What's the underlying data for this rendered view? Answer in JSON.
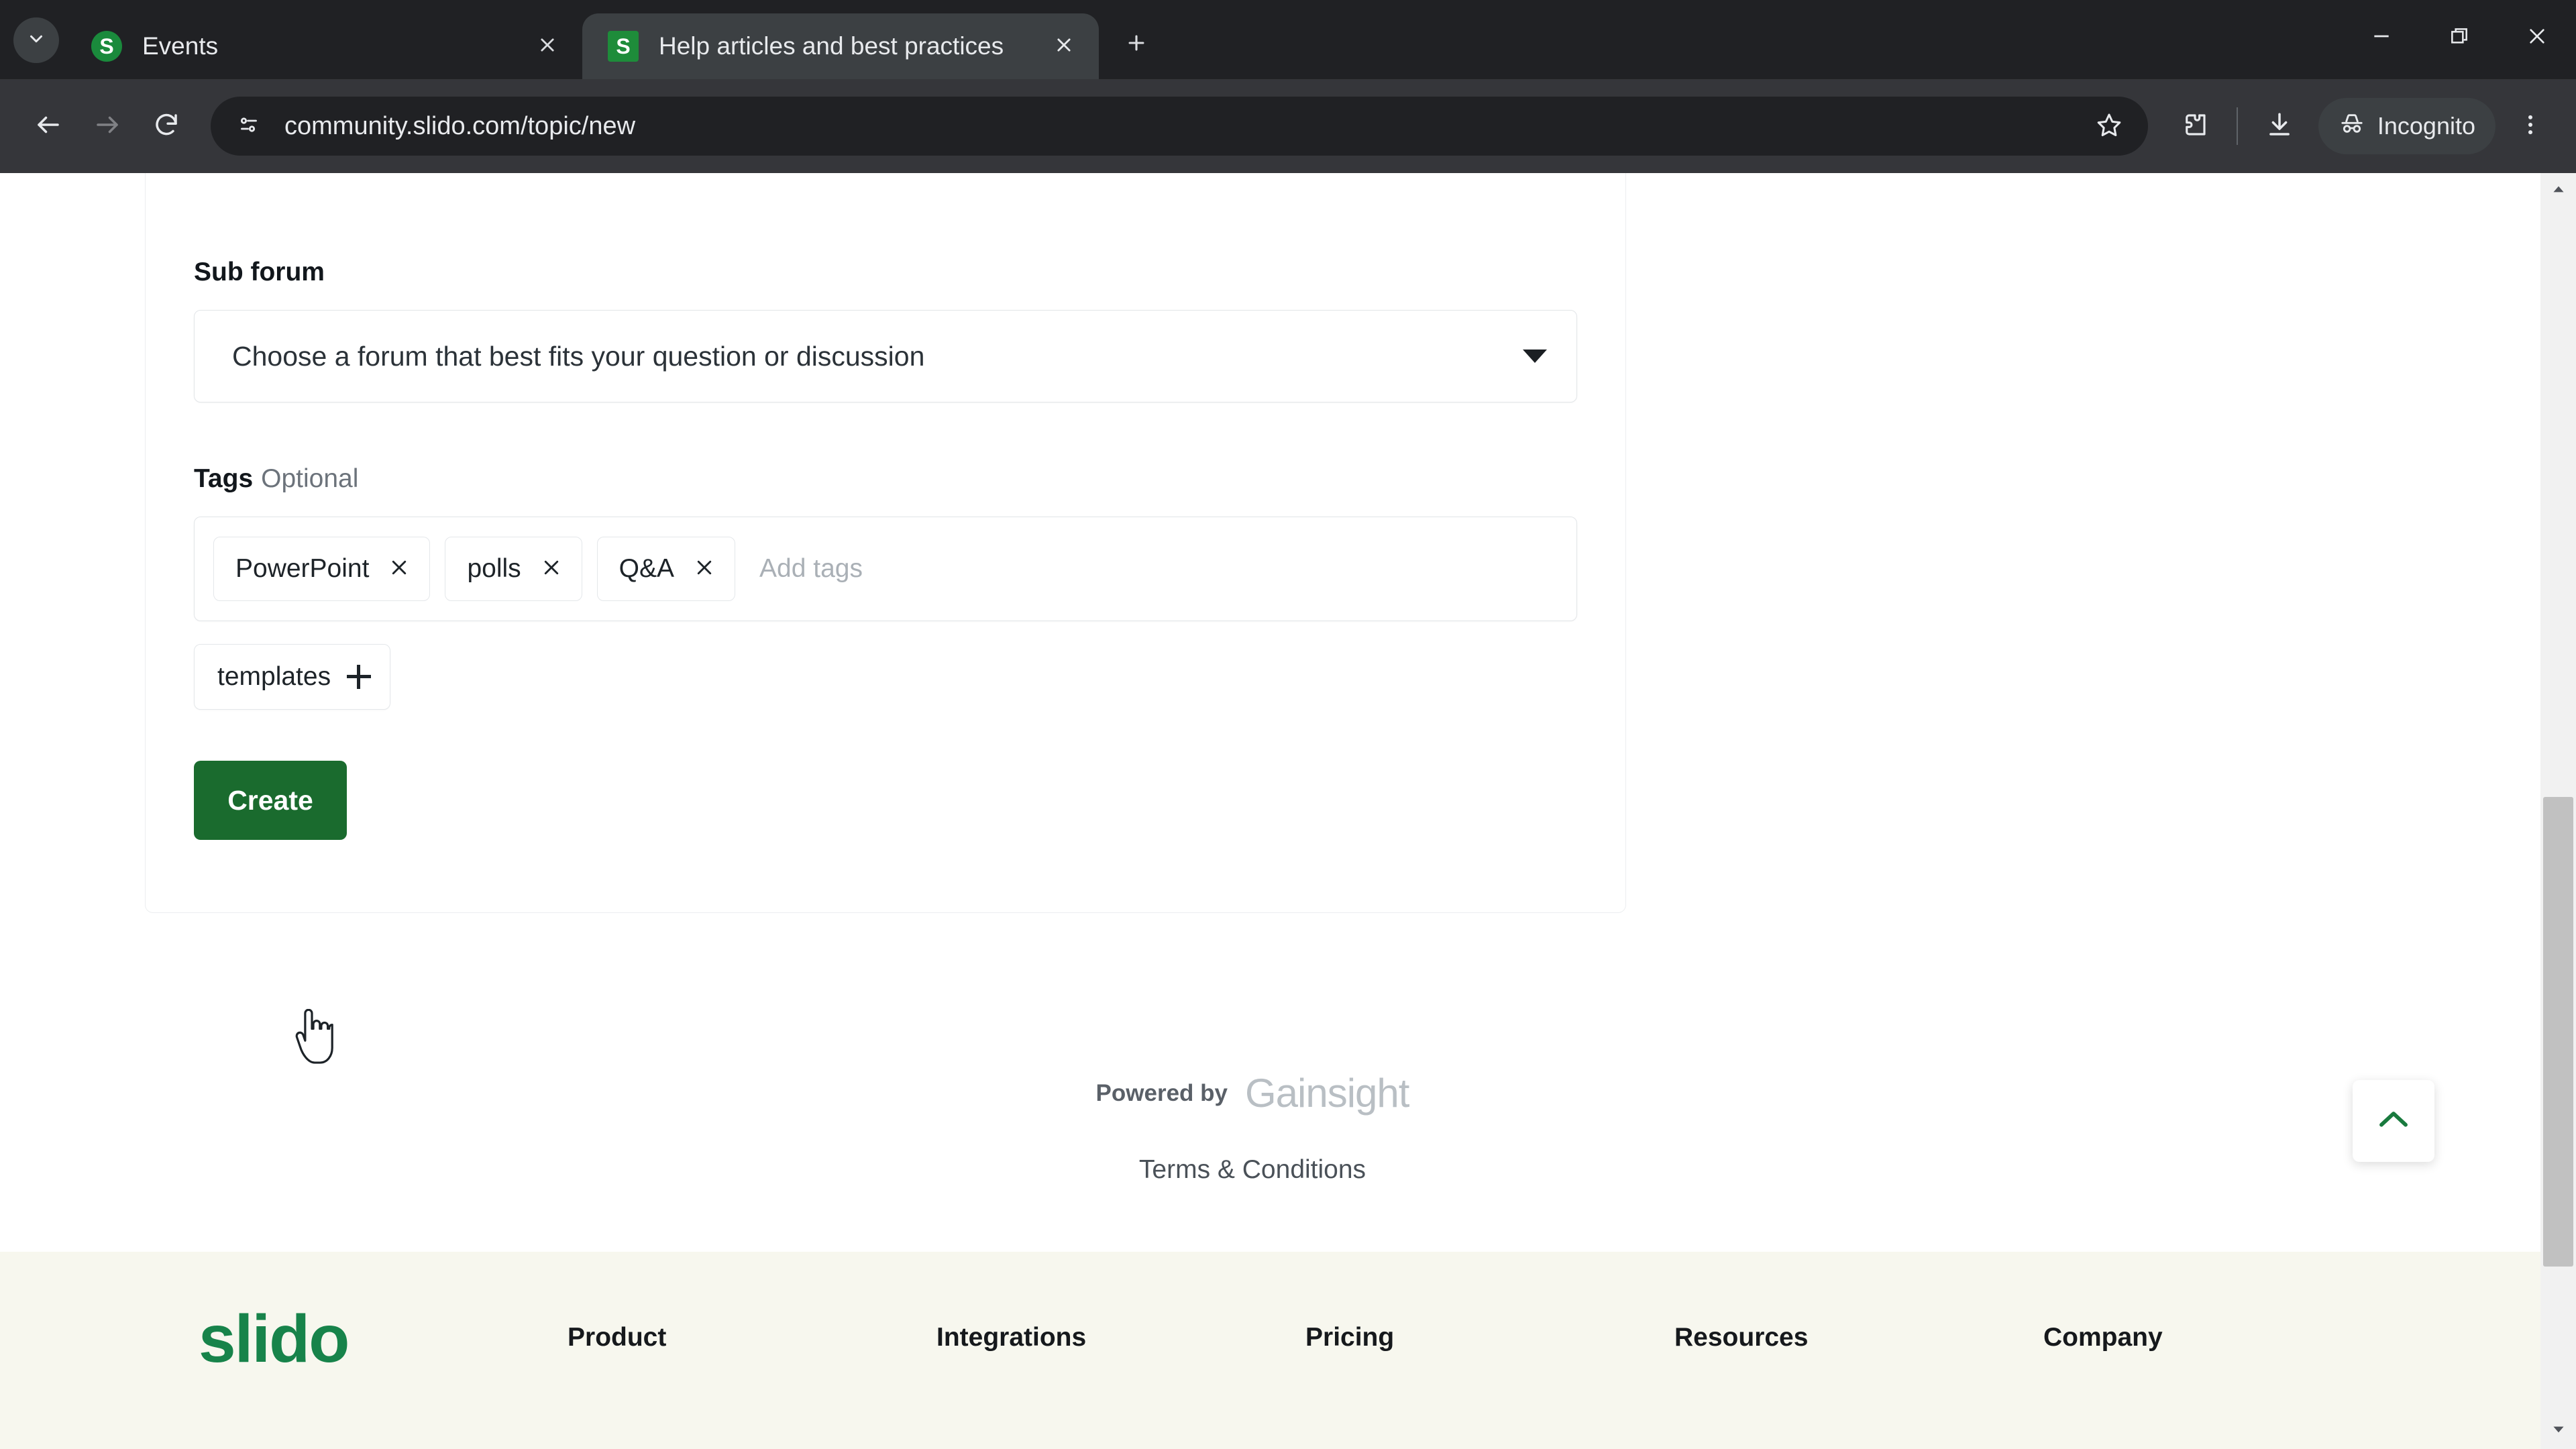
{
  "browser": {
    "tab_search_icon": "chevron-down-icon",
    "tabs": [
      {
        "title": "Events",
        "favicon_letter": "S",
        "favicon_shape": "round",
        "active": false
      },
      {
        "title": "Help articles and best practices",
        "favicon_letter": "S",
        "favicon_shape": "square",
        "active": true
      }
    ],
    "new_tab_icon": "plus-icon",
    "window_controls": [
      "minimize-icon",
      "restore-icon",
      "close-icon"
    ],
    "toolbar": {
      "back_icon": "arrow-left-icon",
      "forward_icon": "arrow-right-icon",
      "reload_icon": "reload-icon",
      "site_info_icon": "site-settings-icon",
      "url": "community.slido.com/topic/new",
      "bookmark_icon": "star-icon",
      "extensions_icon": "extensions-puzzle-icon",
      "download_icon": "download-icon",
      "profile_icon": "incognito-hat-icon",
      "profile_label": "Incognito",
      "menu_icon": "three-dot-menu-icon"
    }
  },
  "form": {
    "subforum": {
      "label": "Sub forum",
      "placeholder": "Choose a forum that best fits your question or discussion",
      "caret_icon": "caret-down-icon"
    },
    "tags": {
      "label": "Tags",
      "optional_label": "Optional",
      "input_placeholder": "Add tags",
      "chips": [
        {
          "text": "PowerPoint",
          "remove_icon": "close-icon"
        },
        {
          "text": "polls",
          "remove_icon": "close-icon"
        },
        {
          "text": "Q&A",
          "remove_icon": "close-icon"
        }
      ],
      "suggestions": [
        {
          "text": "templates",
          "add_icon": "plus-icon"
        }
      ]
    },
    "submit_label": "Create"
  },
  "attribution": {
    "powered_by": "Powered by",
    "brand": "Gainsight",
    "terms": "Terms & Conditions"
  },
  "scroll_top": {
    "icon": "chevron-up-icon"
  },
  "site_footer": {
    "logo": "slido",
    "columns": [
      {
        "title": "Product"
      },
      {
        "title": "Integrations"
      },
      {
        "title": "Pricing"
      },
      {
        "title": "Resources"
      },
      {
        "title": "Company"
      }
    ]
  },
  "colors": {
    "brand_green": "#17834a",
    "button_green": "#1a6b2e",
    "chrome_dark": "#202124",
    "toolbar_dark": "#35363a",
    "footer_cream": "#f7f7ee"
  }
}
